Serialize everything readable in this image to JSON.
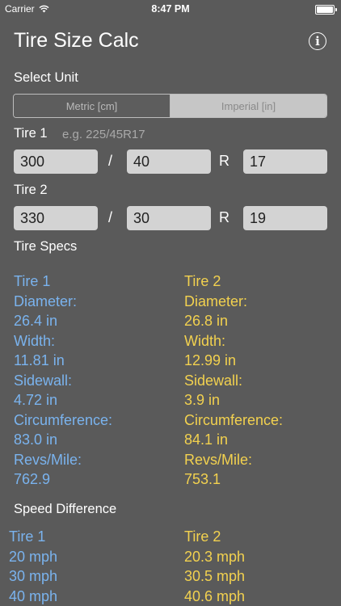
{
  "status_bar": {
    "carrier": "Carrier",
    "time": "8:47 PM"
  },
  "nav": {
    "title": "Tire Size Calc"
  },
  "unit_section": {
    "label": "Select Unit",
    "options": [
      "Metric [cm]",
      "Imperial [in]"
    ],
    "selected": "Imperial [in]"
  },
  "tire1": {
    "label": "Tire 1",
    "hint": "e.g. 225/45R17",
    "width": "300",
    "aspect": "40",
    "rim": "17"
  },
  "tire2": {
    "label": "Tire 2",
    "width": "330",
    "aspect": "30",
    "rim": "19"
  },
  "separators": {
    "slash": "/",
    "r": "R"
  },
  "specs": {
    "label": "Tire Specs",
    "tire1": {
      "header": "Tire 1",
      "diameter_label": "Diameter:",
      "diameter": "26.4 in",
      "width_label": "Width:",
      "width": "11.81 in",
      "sidewall_label": "Sidewall:",
      "sidewall": "4.72 in",
      "circumference_label": "Circumference:",
      "circumference": "83.0 in",
      "revs_label": "Revs/Mile:",
      "revs": "762.9"
    },
    "tire2": {
      "header": "Tire 2",
      "diameter_label": "Diameter:",
      "diameter": "26.8 in",
      "width_label": "Width:",
      "width": "12.99 in",
      "sidewall_label": "Sidewall:",
      "sidewall": "3.9 in",
      "circumference_label": "Circumference:",
      "circumference": "84.1 in",
      "revs_label": "Revs/Mile:",
      "revs": "753.1"
    }
  },
  "speed": {
    "label": "Speed Difference",
    "tire1": {
      "header": "Tire 1",
      "rows": [
        "20 mph",
        "30 mph",
        "40 mph"
      ]
    },
    "tire2": {
      "header": "Tire 2",
      "rows": [
        "20.3 mph",
        "30.5 mph",
        "40.6 mph"
      ]
    }
  },
  "colors": {
    "background": "#5a5a5a",
    "tire1_text": "#7ab3ee",
    "tire2_text": "#f2d14f"
  },
  "icons": {
    "wifi": "wifi-icon",
    "battery": "battery-icon",
    "info": "info-icon"
  }
}
